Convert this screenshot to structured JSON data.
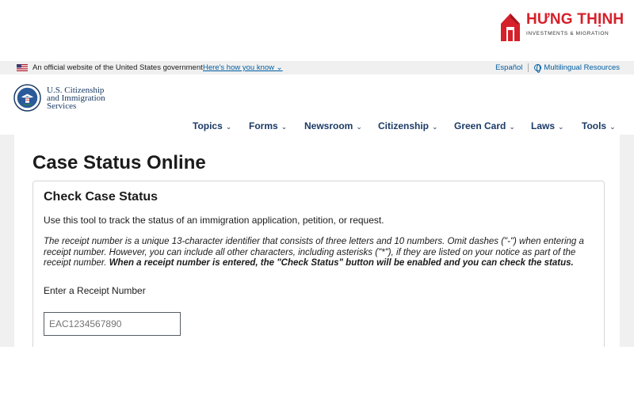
{
  "brand": {
    "name": "HƯNG THỊNH",
    "tagline": "INVESTMENTS & MIGRATION",
    "color": "#d6202a"
  },
  "gov_banner": {
    "text": "An official website of the United States government",
    "link": "Here's how you know",
    "espanol": "Español",
    "multilingual": "Multilingual Resources"
  },
  "agency": {
    "line1": "U.S. Citizenship",
    "line2": "and Immigration",
    "line3": "Services"
  },
  "nav": {
    "items": [
      {
        "label": "Topics"
      },
      {
        "label": "Forms"
      },
      {
        "label": "Newsroom"
      },
      {
        "label": "Citizenship"
      },
      {
        "label": "Green Card"
      },
      {
        "label": "Laws"
      },
      {
        "label": "Tools"
      }
    ]
  },
  "main": {
    "title": "Case Status Online",
    "box_title": "Check Case Status",
    "intro": "Use this tool to track the status of an immigration application, petition, or request.",
    "help_italic": "The receipt number is a unique 13-character identifier that consists of three letters and 10 numbers. Omit dashes (\"-\") when entering a receipt number. However, you can include all other characters, including asterisks (\"*\"), if they are listed on your notice as part of the receipt number.",
    "help_bold": "When a receipt number is entered, the \"Check Status\" button will be enabled and you can check the status.",
    "field_label": "Enter a Receipt Number",
    "receipt_placeholder": "EAC1234567890"
  },
  "colors": {
    "link": "#005ea2",
    "nav": "#1b3a66",
    "banner_bg": "#f0f0f0"
  }
}
